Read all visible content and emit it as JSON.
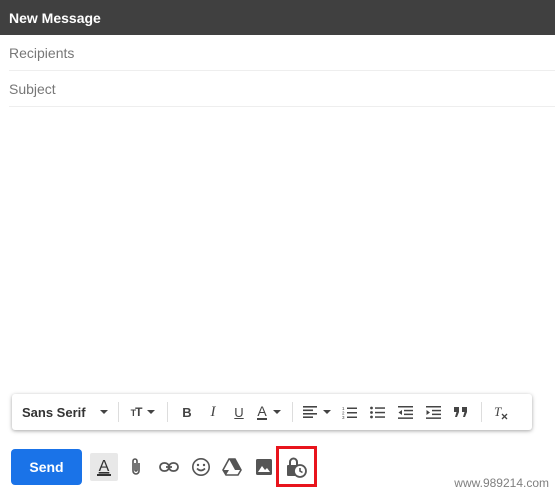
{
  "window": {
    "title": "New Message"
  },
  "compose": {
    "recipients_placeholder": "Recipients",
    "subject_placeholder": "Subject"
  },
  "format_bar": {
    "font_family": "Sans Serif",
    "icons": [
      "text-size-icon",
      "bold-icon",
      "italic-icon",
      "underline-icon",
      "text-color-icon",
      "align-icon",
      "numbered-list-icon",
      "bulleted-list-icon",
      "indent-less-icon",
      "indent-more-icon",
      "quote-icon",
      "remove-formatting-icon"
    ],
    "bold": "B",
    "italic": "I",
    "underline": "U",
    "text_color": "A"
  },
  "bottom_bar": {
    "send_label": "Send",
    "icons": [
      "formatting-options-icon",
      "attach-icon",
      "link-icon",
      "emoji-icon",
      "drive-icon",
      "photo-icon",
      "confidential-mode-icon"
    ],
    "highlight_color": "#e8141c"
  },
  "watermark": "www.989214.com"
}
